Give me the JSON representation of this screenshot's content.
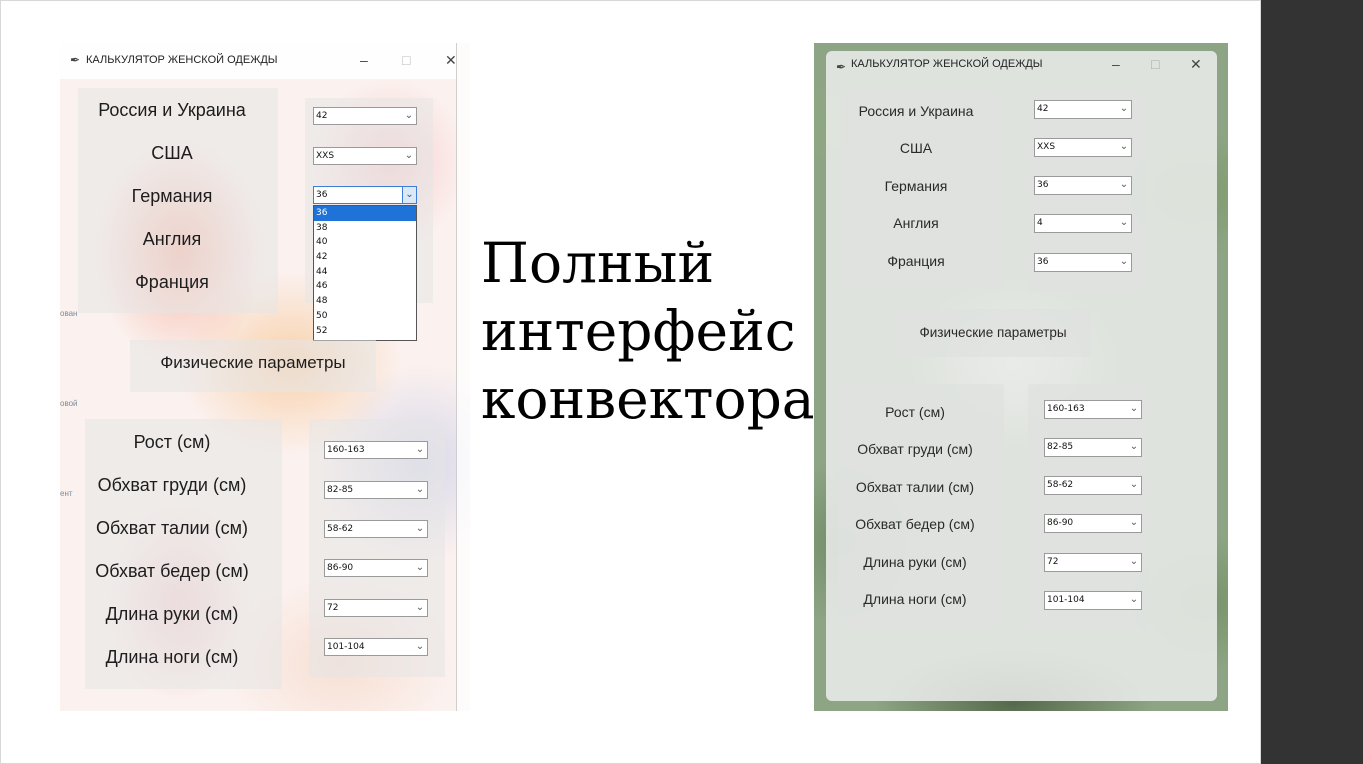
{
  "slide": {
    "heading_lines": [
      "Полный",
      "интерфейс",
      "конвектора"
    ]
  },
  "window_title": "КАЛЬКУЛЯТОР ЖЕНСКОЙ ОДЕЖДЫ",
  "controls": {
    "minimize": "–",
    "maximize": "□",
    "close": "✕"
  },
  "sizes": {
    "labels": [
      "Россия и Украина",
      "США",
      "Германия",
      "Англия",
      "Франция"
    ]
  },
  "physical": {
    "button_label": "Физические параметры",
    "labels": [
      "Рост (см)",
      "Обхват груди (см)",
      "Обхват талии (см)",
      "Обхват бедер (см)",
      "Длина руки (см)",
      "Длина ноги (см)"
    ],
    "values": [
      "160-163",
      "82-85",
      "58-62",
      "86-90",
      "72",
      "101-104"
    ]
  },
  "left_window": {
    "size_values_visible": [
      "42",
      "XXS",
      "36"
    ],
    "germany_dropdown_options": [
      "36",
      "38",
      "40",
      "42",
      "44",
      "46",
      "48",
      "50",
      "52"
    ],
    "germany_dropdown_selected": "36"
  },
  "right_window": {
    "size_values": [
      "42",
      "XXS",
      "36",
      "4",
      "36"
    ]
  },
  "desktop_fragments": [
    "ован",
    "овой",
    "ент"
  ],
  "icons": [
    "feather-icon",
    "minimize-icon",
    "maximize-icon",
    "close-icon",
    "chevron-down-icon"
  ]
}
